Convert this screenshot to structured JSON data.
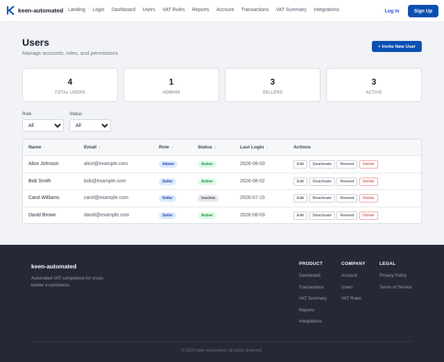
{
  "header": {
    "brand": "keen-automated",
    "nav": [
      "Landing",
      "Login",
      "Dashboard",
      "Users",
      "VAT Rules",
      "Reports",
      "Account",
      "Transactions",
      "VAT Summary",
      "Integrations"
    ],
    "login_label": "Log In",
    "signup_label": "Sign Up",
    "accent_color": "#0b4fb3"
  },
  "page": {
    "title": "Users",
    "subtitle": "Manage accounts, roles, and permissions",
    "invite_label": "+ Invite New User"
  },
  "stats": [
    {
      "value": "4",
      "label": "TOTAL USERS"
    },
    {
      "value": "1",
      "label": "ADMINS"
    },
    {
      "value": "3",
      "label": "SELLERS"
    },
    {
      "value": "3",
      "label": "ACTIVE"
    }
  ],
  "filters": {
    "role_label": "Role",
    "role_value": "All",
    "status_label": "Status",
    "status_value": "All"
  },
  "table": {
    "columns": [
      {
        "label": "Name",
        "sort": "↑"
      },
      {
        "label": "Email",
        "sort": "↕"
      },
      {
        "label": "Role",
        "sort": "↕"
      },
      {
        "label": "Status",
        "sort": "↕"
      },
      {
        "label": "Last Login",
        "sort": "↕"
      },
      {
        "label": "Actions",
        "sort": ""
      }
    ],
    "rows": [
      {
        "name": "Alice Johnson",
        "email": "alice@example.com",
        "role": "Admin",
        "status": "Active",
        "last_login": "2026-08-03",
        "toggle": "Deactivate"
      },
      {
        "name": "Bob Smith",
        "email": "bob@example.com",
        "role": "Seller",
        "status": "Active",
        "last_login": "2026-08-02",
        "toggle": "Deactivate"
      },
      {
        "name": "Carol Williams",
        "email": "carol@example.com",
        "role": "Seller",
        "status": "Inactive",
        "last_login": "2026-07-15",
        "toggle": "Reactivate"
      },
      {
        "name": "David Brown",
        "email": "david@example.com",
        "role": "Seller",
        "status": "Active",
        "last_login": "2026-08-03",
        "toggle": "Deactivate"
      }
    ],
    "edit_label": "Edit",
    "resend_label": "Resend",
    "delete_label": "Delete"
  },
  "footer": {
    "brand": "keen-automated",
    "description": "Automated VAT compliance for cross-border e-commerce.",
    "columns": [
      {
        "heading": "PRODUCT",
        "links": [
          "Dashboard",
          "Transactions",
          "VAT Summary",
          "Reports",
          "Integrations"
        ]
      },
      {
        "heading": "COMPANY",
        "links": [
          "Account",
          "Users",
          "VAT Rules"
        ]
      },
      {
        "heading": "LEGAL",
        "links": [
          "Privacy Policy",
          "Terms of Service"
        ]
      }
    ],
    "copyright": "© 2026 keen-automated. All rights reserved."
  }
}
